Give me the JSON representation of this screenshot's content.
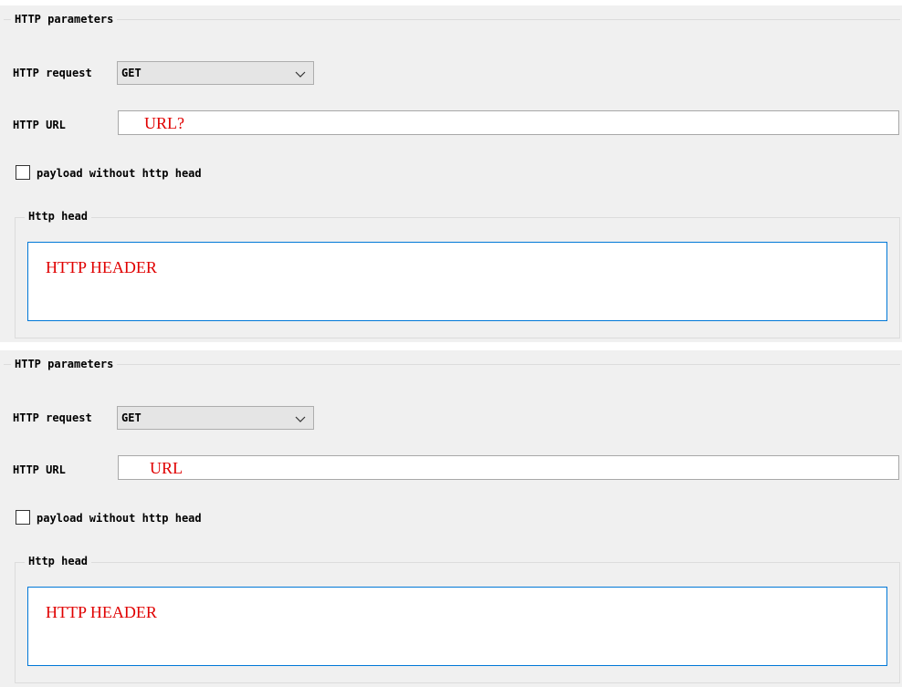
{
  "panels": [
    {
      "group_title": "HTTP parameters",
      "request_label": "HTTP request",
      "request_value": "GET",
      "url_label": "HTTP URL",
      "url_value": "URL?",
      "checkbox_label": "payload without http head",
      "checkbox_checked": false,
      "head_title": "Http head",
      "head_value": "HTTP HEADER"
    },
    {
      "group_title": "HTTP parameters",
      "request_label": "HTTP request",
      "request_value": "GET",
      "url_label": "HTTP URL",
      "url_value": "URL",
      "checkbox_label": "payload without http head",
      "checkbox_checked": false,
      "head_title": "Http head",
      "head_value": "HTTP HEADER"
    }
  ],
  "icons": {
    "dropdown": "chevron-down-icon"
  },
  "colors": {
    "panel_bg": "#f0f0f0",
    "annotation_red": "#e00000",
    "focus_border": "#0078d7"
  }
}
